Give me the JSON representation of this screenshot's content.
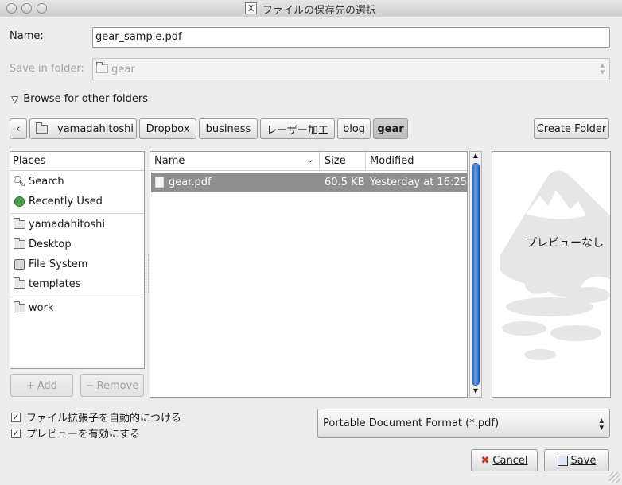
{
  "window": {
    "title": "ファイルの保存先の選択",
    "title_icon": "X"
  },
  "name_field": {
    "label": "Name:",
    "value": "gear_sample.pdf"
  },
  "save_in_folder": {
    "label": "Save in folder:",
    "value": "gear"
  },
  "browse": {
    "label": "Browse for other folders"
  },
  "path_bar": {
    "segments": [
      "yamadahitoshi",
      "Dropbox",
      "business",
      "レーザー加工",
      "blog",
      "gear"
    ],
    "active": "gear"
  },
  "create_folder_label": "Create Folder",
  "places": {
    "header": "Places",
    "items": [
      {
        "label": "Search",
        "icon": "search-icon"
      },
      {
        "label": "Recently Used",
        "icon": "recent-icon"
      },
      {
        "label": "yamadahitoshi",
        "icon": "folder-icon"
      },
      {
        "label": "Desktop",
        "icon": "folder-icon"
      },
      {
        "label": "File System",
        "icon": "drive-icon"
      },
      {
        "label": "templates",
        "icon": "folder-icon"
      },
      {
        "label": "work",
        "icon": "folder-icon"
      }
    ],
    "add_label": "Add",
    "remove_label": "Remove"
  },
  "files": {
    "columns": [
      "Name",
      "Size",
      "Modified"
    ],
    "rows": [
      {
        "name": "gear.pdf",
        "size": "60.5 KB",
        "modified": "Yesterday at 16:25"
      }
    ]
  },
  "preview": {
    "text": "プレビューなし"
  },
  "options": {
    "auto_extension": {
      "label": "ファイル拡張子を自動的につける",
      "checked": true
    },
    "enable_preview": {
      "label": "プレビューを有効にする",
      "checked": true
    }
  },
  "file_type": {
    "value": "Portable Document Format (*.pdf)"
  },
  "cancel_label": "Cancel",
  "save_label": "Save",
  "colors": {
    "selection": "#8f8f8f",
    "scroll_thumb": "#3b7de0"
  }
}
